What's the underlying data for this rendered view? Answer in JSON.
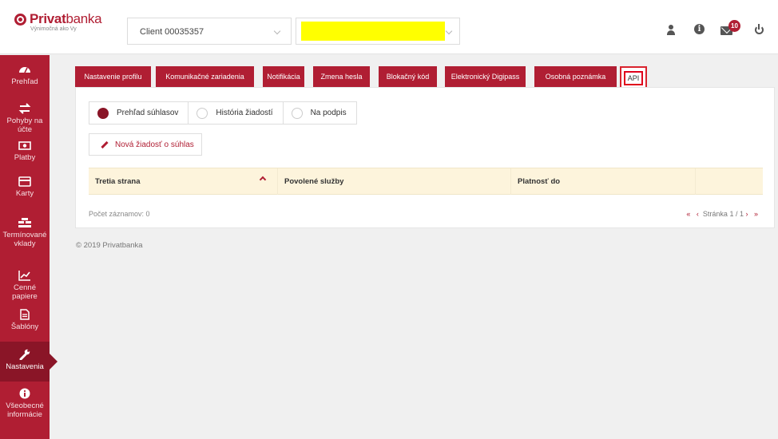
{
  "header": {
    "logo_bold": "Privat",
    "logo_light": "banka",
    "tagline": "Výnimočná ako Vy",
    "client_select": "Client 00035357",
    "mail_badge": "10"
  },
  "sidebar": {
    "items": [
      {
        "label": "Prehľad",
        "icon": "dashboard-icon"
      },
      {
        "label": "Pohyby na účte",
        "icon": "exchange-icon"
      },
      {
        "label": "Platby",
        "icon": "money-icon"
      },
      {
        "label": "Karty",
        "icon": "card-icon"
      },
      {
        "label": "Termínované vklady",
        "icon": "deposit-icon"
      },
      {
        "label": "Cenné papiere",
        "icon": "chart-line-icon"
      },
      {
        "label": "Šablóny",
        "icon": "template-icon"
      },
      {
        "label": "Nastavenia",
        "icon": "wrench-icon"
      },
      {
        "label": "Všeobecné informácie",
        "icon": "info-icon"
      }
    ]
  },
  "tabs": [
    "Nastavenie profilu",
    "Komunikačné zariadenia",
    "Notifikácia",
    "Zmena hesla",
    "Blokačný kód",
    "Elektronický Digipass",
    "Osobná poznámka",
    "API"
  ],
  "radios": [
    "Prehľad súhlasov",
    "História žiadostí",
    "Na podpis"
  ],
  "new_button": "Nová žiadosť o súhlas",
  "table": {
    "columns": [
      "Tretia strana",
      "Povolené služby",
      "Platnosť do",
      ""
    ]
  },
  "records_count": "Počet záznamov: 0",
  "pager": {
    "first": "«",
    "prev": "‹",
    "page_text": "Stránka 1 / 1",
    "next": "›",
    "last": "»"
  },
  "footer": "© 2019 Privatbanka",
  "colors": {
    "brand": "#b01e33",
    "brand_dark": "#8a1527",
    "table_header": "#fdf4dc"
  }
}
